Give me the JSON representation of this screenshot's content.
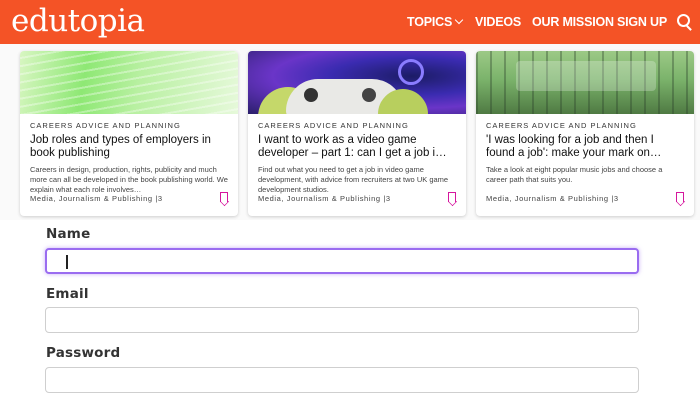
{
  "header": {
    "logo_text": "edutopia",
    "nav": [
      {
        "label": "TOPICS",
        "has_dropdown": true
      },
      {
        "label": "VIDEOS"
      },
      {
        "label": "OUR MISSION"
      },
      {
        "label": "SIGN UP"
      }
    ],
    "search_icon": "search-icon",
    "bg_color": "#f45326"
  },
  "cards": [
    {
      "kicker": "CAREERS ADVICE AND PLANNING",
      "title": "Job roles and types of employers in book publishing",
      "description": "Careers in design, production, rights, publicity and much more can all be developed in the book publishing world. We explain what each role involves…",
      "meta": "Media, Journalism & Publishing  |3",
      "bookmark_icon": "bookmark-icon"
    },
    {
      "kicker": "CAREERS ADVICE AND PLANNING",
      "title": "I want to work as a video game developer – part 1: can I get a job i…",
      "description": "Find out what you need to get a job in video game development, with advice from recruiters at two UK game development studios.",
      "meta": "Media, Journalism & Publishing  |3",
      "bookmark_icon": "bookmark-icon"
    },
    {
      "kicker": "CAREERS ADVICE AND PLANNING",
      "title": "'I was looking for a job and then I found a job': make your mark on…",
      "description": "Take a look at eight popular music jobs and choose a career path that suits you.",
      "meta": "Media, Journalism & Publishing  |3",
      "bookmark_icon": "bookmark-icon"
    }
  ],
  "form": {
    "name_label": "Name",
    "name_value": "",
    "email_label": "Email",
    "email_value": "",
    "password_label": "Password",
    "password_value": "",
    "focus_color": "#9a6cf0"
  }
}
